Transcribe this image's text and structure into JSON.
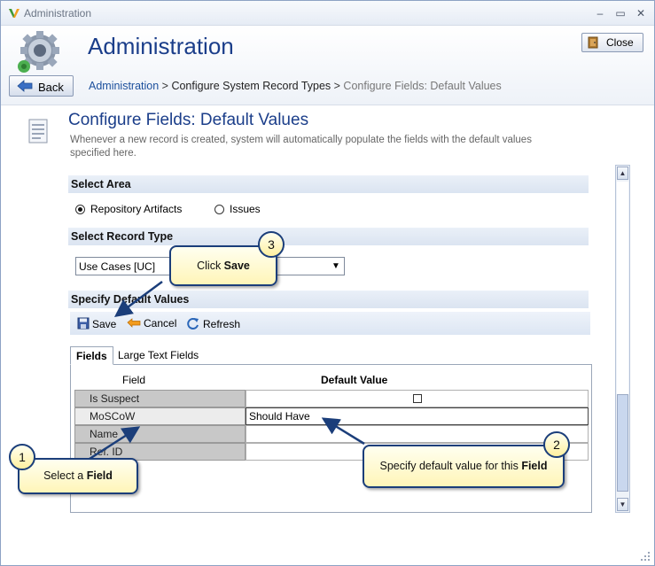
{
  "window": {
    "title": "Administration",
    "minimize": "–",
    "maximize": "▭",
    "close": "✕"
  },
  "header": {
    "app_title": "Administration",
    "close_label": "Close",
    "back_label": "Back",
    "breadcrumb": {
      "root": "Administration",
      "sep1": " > ",
      "middle": "Configure System Record Types",
      "sep2": " > ",
      "current": "Configure Fields: Default Values"
    }
  },
  "page": {
    "title": "Configure Fields: Default Values",
    "description": "Whenever a new record is created, system will automatically populate the fields with the default values specified here."
  },
  "select_area": {
    "heading": "Select Area",
    "options": [
      {
        "label": "Repository Artifacts",
        "selected": true
      },
      {
        "label": "Issues",
        "selected": false
      }
    ]
  },
  "select_record_type": {
    "heading": "Select Record Type",
    "value": "Use Cases [UC]"
  },
  "default_values": {
    "heading": "Specify Default Values",
    "toolbar": {
      "save": "Save",
      "cancel": "Cancel",
      "refresh": "Refresh"
    },
    "tabs": [
      {
        "label": "Fields",
        "active": true
      },
      {
        "label": "Large Text Fields",
        "active": false
      }
    ],
    "columns": {
      "field": "Field",
      "default_value": "Default Value"
    },
    "rows": [
      {
        "field": "Is Suspect",
        "value": "",
        "checkbox": true
      },
      {
        "field": "MoSCoW",
        "value": "Should Have"
      },
      {
        "field": "Name",
        "value": ""
      },
      {
        "field": "Ref. ID",
        "value": ""
      }
    ]
  },
  "callouts": {
    "one": {
      "number": "1",
      "prefix": "Select a ",
      "bold": "Field"
    },
    "two": {
      "number": "2",
      "prefix": "Specify default value for this ",
      "bold": "Field"
    },
    "three": {
      "number": "3",
      "prefix": "Click ",
      "bold": "Save"
    }
  },
  "colors": {
    "accent": "#1b3e8a",
    "callout_border": "#1b3e7a",
    "callout_fill": "#fff5b8"
  }
}
